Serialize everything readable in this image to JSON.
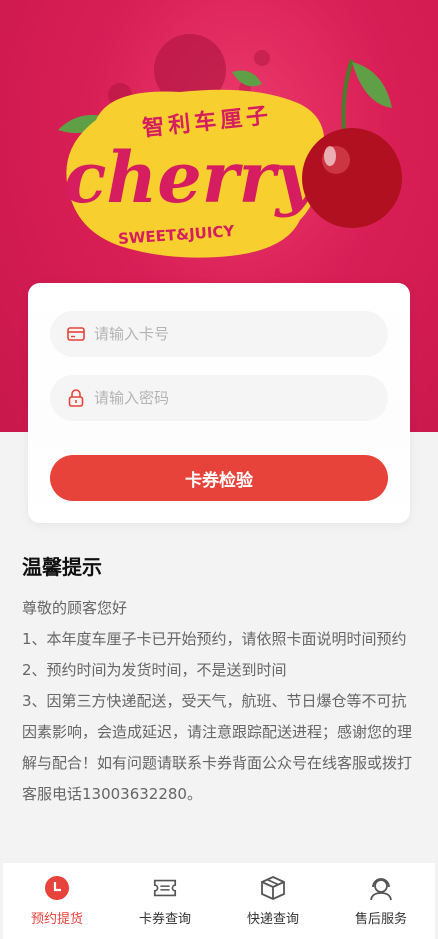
{
  "banner": {
    "brand_cn": "智利车厘子",
    "brand_en": "cherry",
    "slogan": "SWEET&JUICY"
  },
  "login": {
    "card_placeholder": "请输入卡号",
    "password_placeholder": "请输入密码",
    "verify_label": "卡券检验"
  },
  "notice": {
    "title": "温馨提示",
    "lines": [
      "尊敬的顾客您好",
      "1、本年度车厘子卡已开始预约，请依照卡面说明时间预约",
      "2、预约时间为发货时间，不是送到时间",
      "3、因第三方快递配送，受天气，航班、节日爆仓等不可抗因素影响，会造成延迟，请注意跟踪配送进程；感谢您的理解与配合！如有问题请联系卡券背面公众号在线客服或拨打客服电话13003632280。"
    ]
  },
  "tabbar": {
    "items": [
      {
        "label": "预约提货",
        "icon": "clock-icon",
        "active": true
      },
      {
        "label": "卡券查询",
        "icon": "ticket-icon",
        "active": false
      },
      {
        "label": "快递查询",
        "icon": "box-icon",
        "active": false
      },
      {
        "label": "售后服务",
        "icon": "headset-icon",
        "active": false
      }
    ]
  },
  "colors": {
    "accent": "#e8433a",
    "banner": "#d81e55",
    "logo_yellow": "#f7cf2f",
    "logo_pink": "#d61d5f"
  }
}
